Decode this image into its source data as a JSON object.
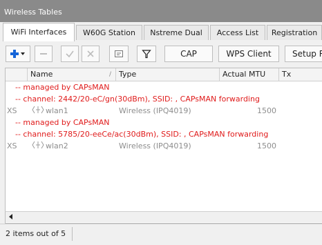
{
  "window": {
    "title": "Wireless Tables"
  },
  "tabs": [
    {
      "label": "WiFi Interfaces",
      "active": true
    },
    {
      "label": "W60G Station",
      "active": false
    },
    {
      "label": "Nstreme Dual",
      "active": false
    },
    {
      "label": "Access List",
      "active": false
    },
    {
      "label": "Registration",
      "active": false
    }
  ],
  "toolbar": {
    "cap_label": "CAP",
    "wps_client_label": "WPS Client",
    "setup_label": "Setup R",
    "add_color": "#1565d8"
  },
  "table": {
    "columns": [
      "Name",
      "Type",
      "Actual MTU",
      "Tx"
    ],
    "rows": [
      {
        "kind": "comment",
        "text": "-- managed by CAPsMAN"
      },
      {
        "kind": "comment",
        "text": "-- channel: 2442/20-eC/gn(30dBm), SSID: , CAPsMAN forwarding"
      },
      {
        "kind": "data",
        "flags": "XS",
        "name": "wlan1",
        "type": "Wireless (IPQ4019)",
        "mtu": "1500"
      },
      {
        "kind": "comment",
        "text": "-- managed by CAPsMAN"
      },
      {
        "kind": "comment",
        "text": "-- channel: 5785/20-eeCe/ac(30dBm), SSID: , CAPsMAN forwarding"
      },
      {
        "kind": "data",
        "flags": "XS",
        "name": "wlan2",
        "type": "Wireless (IPQ4019)",
        "mtu": "1500"
      }
    ]
  },
  "status": {
    "text": "2 items out of 5"
  },
  "colors": {
    "comment": "#e01b1b",
    "disabled_text": "#8d8d8d",
    "titlebar": "#8a8a8a"
  }
}
